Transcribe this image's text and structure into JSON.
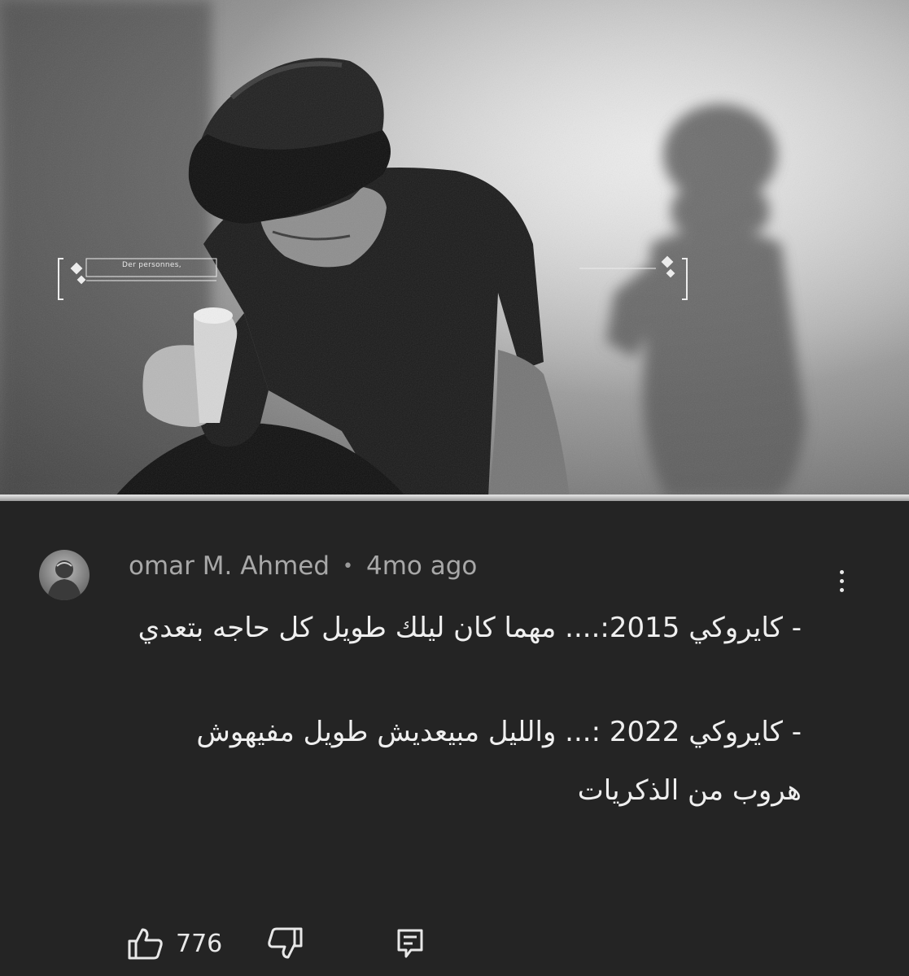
{
  "thumbnail": {
    "caption": "Der personnes,",
    "photo_icon": "black-and-white-concert-photo"
  },
  "comment": {
    "author": "omar M. Ahmed",
    "separator": "•",
    "time": "4mo ago",
    "more_icon": "vertical-ellipsis-icon",
    "lines": [
      "- كايروكي 2015:.... مهما كان ليلك طويل كل حاجه بتعدي",
      "- كايروكي 2022 :... والليل مبيعديش طويل مفيهوش هروب من الذكريات"
    ]
  },
  "actions": {
    "like_icon": "thumbs-up-icon",
    "like_count": "776",
    "dislike_icon": "thumbs-down-icon",
    "reply_icon": "comment-reply-icon"
  },
  "colors": {
    "panel_bg": "#242424",
    "text_primary": "#efefef",
    "text_secondary": "#a8a8a8"
  }
}
